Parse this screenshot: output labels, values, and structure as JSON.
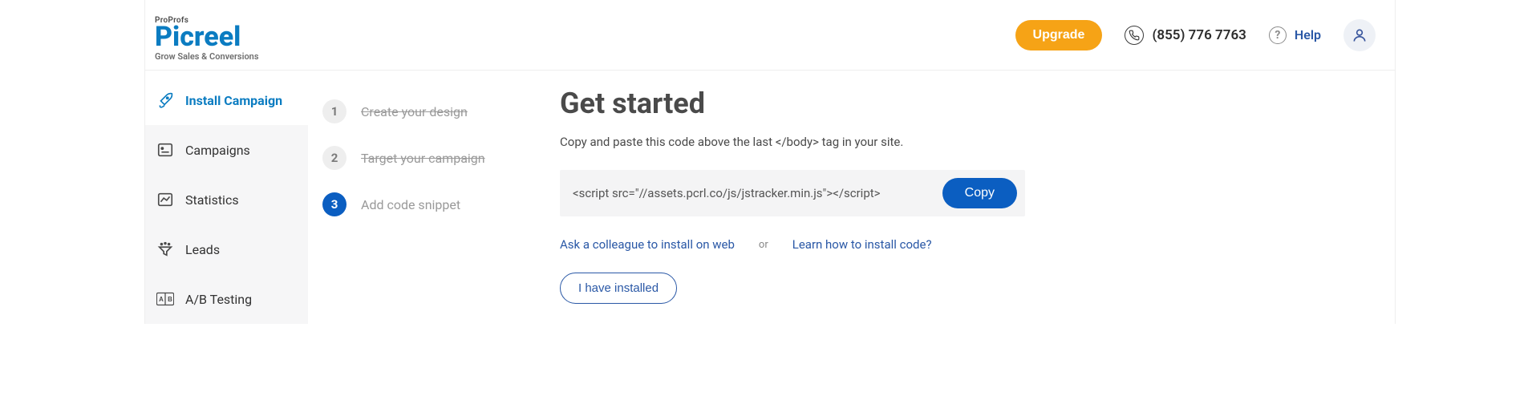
{
  "header": {
    "logo_pre": "ProProfs",
    "logo_main": "Picreel",
    "logo_sub": "Grow Sales & Conversions",
    "upgrade_label": "Upgrade",
    "phone": "(855) 776 7763",
    "help_label": "Help"
  },
  "sidebar": {
    "items": [
      {
        "label": "Install Campaign"
      },
      {
        "label": "Campaigns"
      },
      {
        "label": "Statistics"
      },
      {
        "label": "Leads"
      },
      {
        "label": "A/B Testing"
      }
    ]
  },
  "steps": [
    {
      "num": "1",
      "label": "Create your design"
    },
    {
      "num": "2",
      "label": "Target your campaign"
    },
    {
      "num": "3",
      "label": "Add code snippet"
    }
  ],
  "main": {
    "title": "Get started",
    "desc": "Copy and paste this code above the last </body> tag in your site.",
    "code_snippet": "<script src=\"//assets.pcrl.co/js/jstracker.min.js\"></script>",
    "copy_label": "Copy",
    "link_colleague": "Ask a colleague to install on web",
    "or": "or",
    "link_learn": "Learn how to install code?",
    "installed_label": "I have installed"
  }
}
